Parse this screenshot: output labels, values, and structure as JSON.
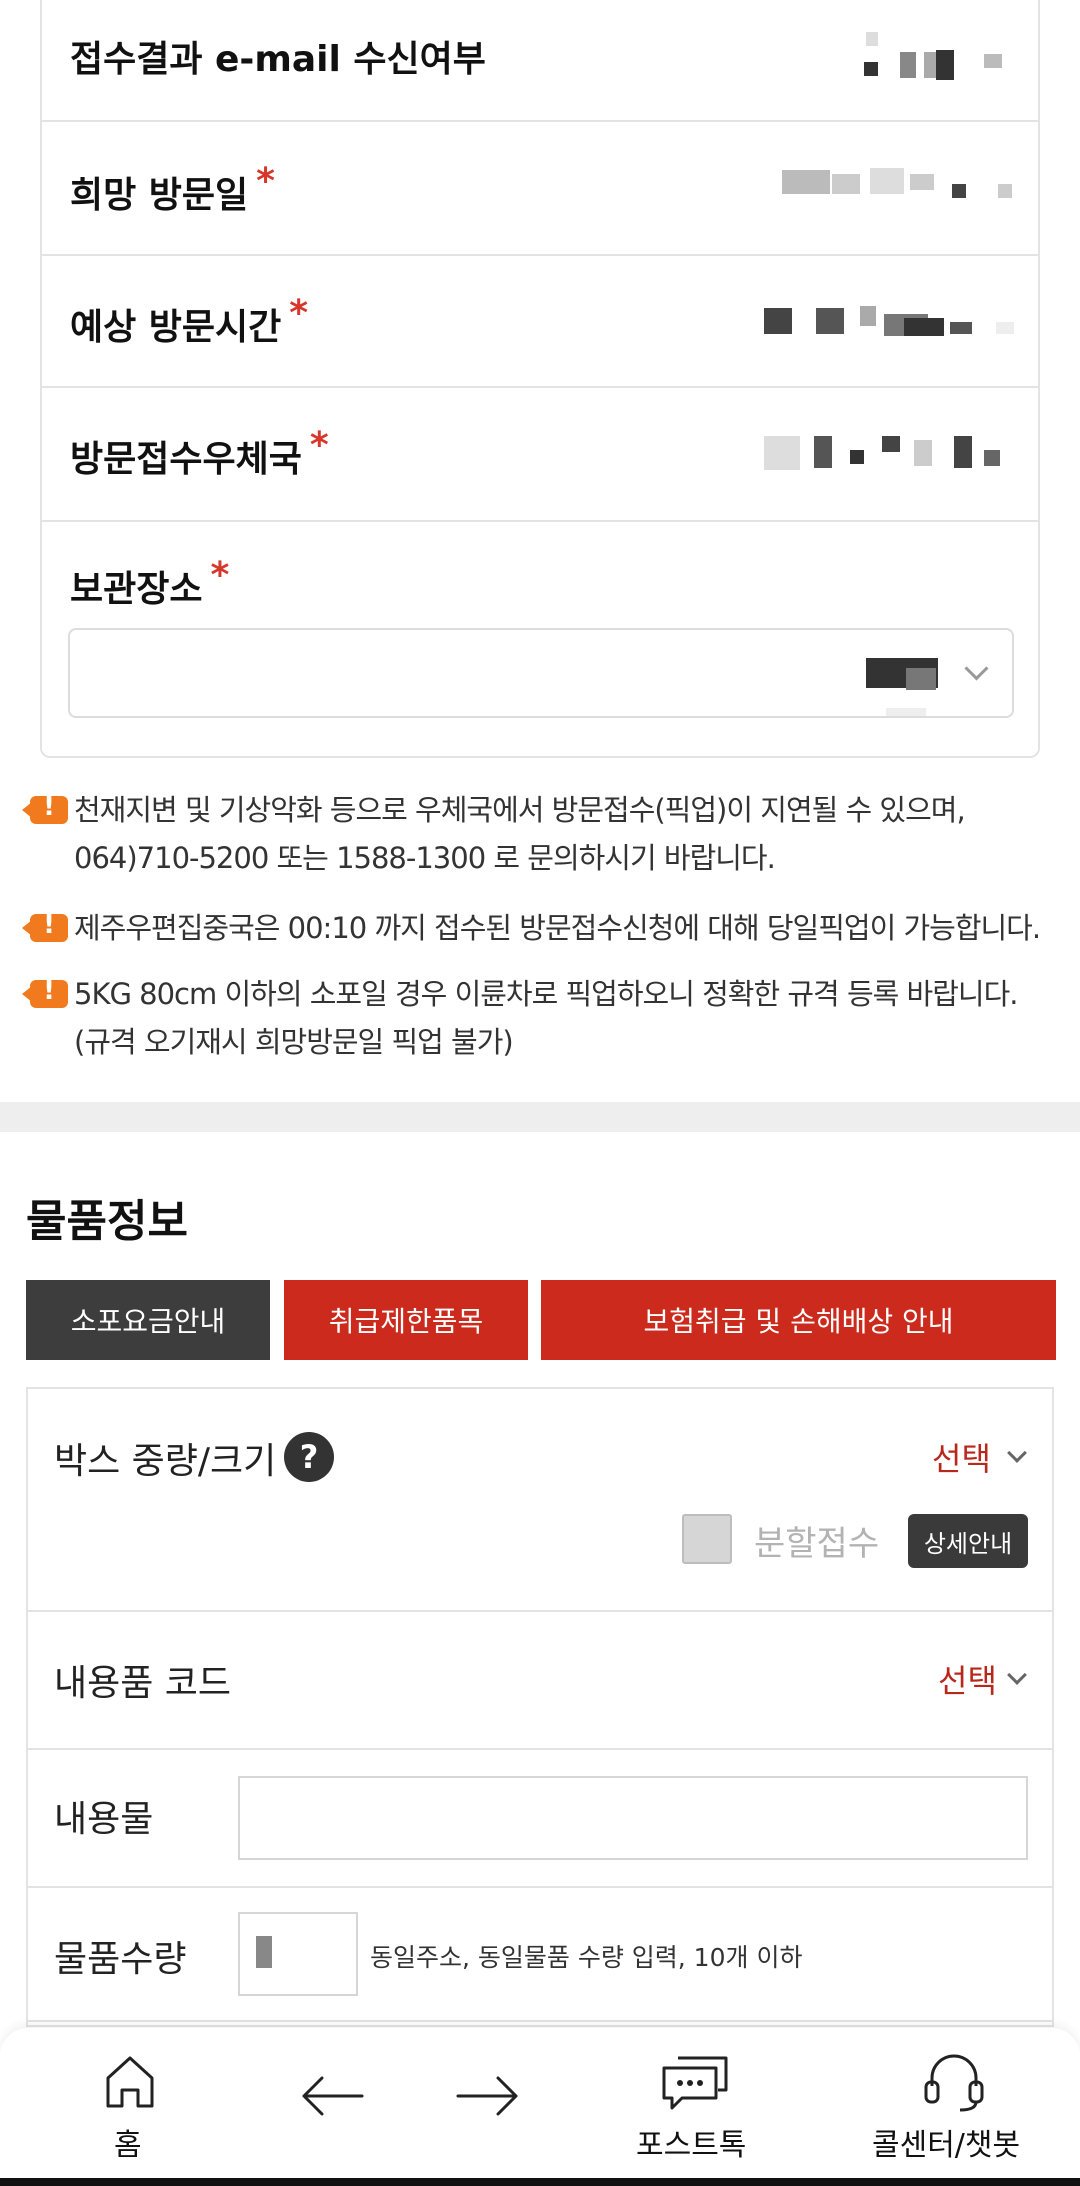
{
  "form": {
    "rows": [
      {
        "label": "접수결과 e-mail 수신여부",
        "required": ""
      },
      {
        "label": "희망 방문일",
        "required": "*"
      },
      {
        "label": "예상 방문시간",
        "required": "*"
      },
      {
        "label": "방문접수우체국",
        "required": "*"
      },
      {
        "label": "보관장소",
        "required": "*"
      }
    ]
  },
  "notices": [
    "천재지변 및 기상악화 등으로 우체국에서 방문접수(픽업)이 지연될 수 있으며, 064)710-5200 또는 1588-1300 로 문의하시기 바랍니다.",
    "제주우편집중국은 00:10 까지 접수된 방문접수신청에 대해 당일픽업이 가능합니다.",
    "5KG 80cm 이하의 소포일 경우 이륜차로 픽업하오니 정확한 규격 등록 바랍니다. (규격 오기재시 희망방문일 픽업 불가)"
  ],
  "goods": {
    "title": "물품정보",
    "buttons": [
      "소포요금안내",
      "취급제한품목",
      "보험취급 및 손해배상 안내"
    ],
    "box_label": "박스 중량/크기",
    "help": "?",
    "select": "선택",
    "split_label": "분할접수",
    "detail_label": "상세안내",
    "code_label": "내용품 코드",
    "content_label": "내용물",
    "qty_label": "물품수량",
    "qty_hint": "동일주소, 동일물품 수량 입력, 10개 이하"
  },
  "nav": {
    "home": "홈",
    "posttalk": "포스트톡",
    "callcenter": "콜센터/챗봇"
  },
  "colors": {
    "accent": "#cc2a1c",
    "dark": "#3d3d3d",
    "notice": "#f07a1d"
  }
}
